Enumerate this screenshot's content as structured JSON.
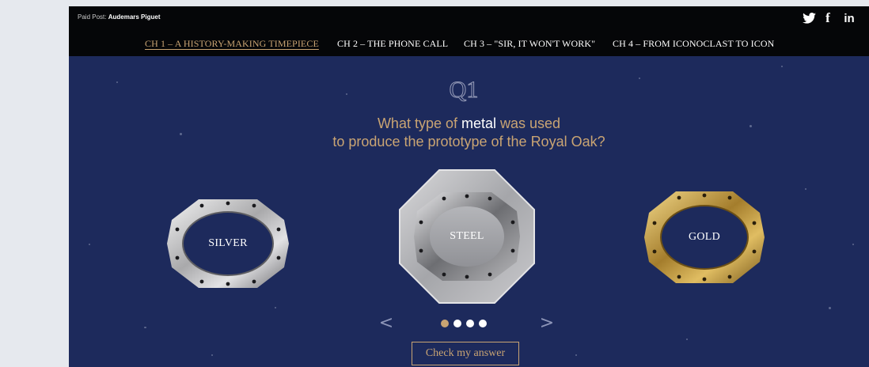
{
  "header": {
    "paid_prefix": "Paid Post:",
    "sponsor": "Audemars Piguet",
    "social": [
      "twitter-icon",
      "facebook-icon",
      "linkedin-icon"
    ],
    "facebook_glyph": "f",
    "linkedin_glyph": "in"
  },
  "chapters": [
    {
      "label": "CH 1 – A HISTORY-MAKING TIMEPIECE",
      "active": true
    },
    {
      "label": "CH 2 – THE PHONE CALL",
      "active": false
    },
    {
      "label": "CH 3 – \"SIR, IT WON'T WORK\"",
      "active": false
    },
    {
      "label": "CH 4 – FROM ICONOCLAST TO ICON",
      "active": false
    }
  ],
  "quiz": {
    "badge": "Q1",
    "question_before": "What type of ",
    "question_highlight": "metal",
    "question_after": " was used",
    "question_line2": "to produce the prototype of the Royal Oak?",
    "options": [
      {
        "label": "SILVER",
        "selected": false
      },
      {
        "label": "STEEL",
        "selected": true
      },
      {
        "label": "GOLD",
        "selected": false
      }
    ],
    "prev_arrow": "<",
    "next_arrow": ">",
    "pages": 4,
    "current_page": 1,
    "submit_label": "Check my answer"
  },
  "colors": {
    "background": "#1d2a5c",
    "nav_background": "#050608",
    "accent_gold": "#c9a473",
    "text_white": "#ffffff"
  }
}
